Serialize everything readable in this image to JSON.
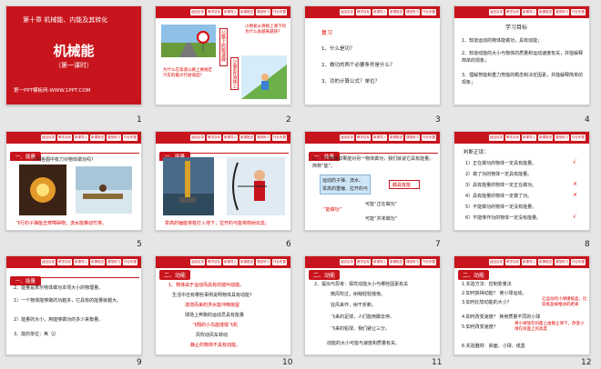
{
  "toolbar": [
    "返回目录",
    "教学目标",
    "新课导入",
    "新课推进",
    "课堂练习",
    "作业布置"
  ],
  "slide1": {
    "num": "1",
    "chapter": "第十章  机械能、内能及其转化",
    "title": "机械能",
    "subtitle": "（第一课时）",
    "site": "第一PPT模板网-WWW.1PPT.COM"
  },
  "slide2": {
    "num": "2",
    "callout_top": "小明发从滑梯上滑下的为什么会越来越快?",
    "road_sign": "公路上的限速牌",
    "callout_bottom": "为什么在高速公路上要规定汽车的最大行驶速度?",
    "slide_sign": "小朋友在滑梯上"
  },
  "slide3": {
    "num": "3",
    "heading": "复习",
    "items": [
      "1、什么是功？",
      "2、做功的两个必要条件是什么？",
      "3、功的计算公式？单位？"
    ]
  },
  "slide4": {
    "num": "4",
    "heading": "学习目标",
    "lines": [
      "1、知道运动的物体能做功，具有动能；",
      "2、知道动能的大小与物体的质量和运动速度有关，并能解释简单的现象；",
      "3、理解势能和重力势能的概念和决定因素，并能解释简单的现象；"
    ]
  },
  "slide5": {
    "num": "5",
    "tab": "一、能量",
    "question": "下列各图中有力对物体做功吗？",
    "caption": "飞行的子弹能击穿障碍物；流水能推动竹排。"
  },
  "slide6": {
    "num": "6",
    "tab": "一、能量",
    "caption": "举高的锤能将桩打入地下；拉开的弓能将箭射出去。"
  },
  "slide7": {
    "num": "7",
    "tab": "一、能量",
    "line1": "1、一个物体如果能对另一物体做功，我们就说它具有能量。简称“能”。",
    "box_lines": [
      "运动的子弹、流水、",
      "举高的重锤、拉开的弓"
    ],
    "has_energy": "都具有能",
    "can_do": "“能做功”",
    "doing": "可能“正在做功”",
    "not_doing": "可能“并未做功”"
  },
  "slide8": {
    "num": "8",
    "heading": "判断正误：",
    "items": [
      "1）正在做功的物体一定具有能量。",
      "2）做了功的物体一定具有能量。",
      "3）具有能量的物体一定正在做功。",
      "4）具有能量的物体一定做了功。",
      "5）不能做功的物体一定没有能量。",
      "6）不能够作功的物体一定没有能量。"
    ],
    "marks": [
      "√",
      "",
      "×",
      "×",
      "",
      "√"
    ]
  },
  "slide9": {
    "num": "9",
    "tab": "一、能量",
    "lines": [
      "2、能量是表示物体做功本领大小的物理量。",
      "1）一个物体能够做的功越多，它具有的能量就越大。",
      "2）能量的大小，用能够做功的多少来衡量。",
      "3、能的单位：焦（J）"
    ]
  },
  "slide10": {
    "num": "10",
    "tab": "二、动能",
    "lines": [
      "1、物体由于运动而具有的能叫动能。",
      "生活中还有哪些事例说明物体具有动能?",
      "湍流而来的洪水能冲倒房屋",
      "球场上奔跑的运动员具有能量",
      "飞翔的小鸟能撞毁飞机",
      "风吹动风车转动",
      "静止的物体不具有动能。"
    ]
  },
  "slide11": {
    "num": "11",
    "tab": "二、动能",
    "line1": "2、提出与思考：探究动能大小与哪些因素有关",
    "lines": [
      "微风吹过，树稍轻轻摇曳。",
      "狂风来作，树干折断。",
      "飞来的足球，人们能用脚去停。",
      "飞来的铅球，我们避让三分。"
    ],
    "conclusion": "动能的大小可能与速度和质量有关。"
  },
  "slide12": {
    "num": "12",
    "tab": "二、动能",
    "lines": [
      "1.实验方法：控制变量法",
      "2.如何获得动能？  使小球运动。",
      "3.如何比较动能的大小？",
      "4.如何改变速度？  换用质量不同的小球",
      "5.如何改变速度？",
      "6.实验器材：斜面、小球、纸盒"
    ],
    "answer3": "让运动的小球撞纸盒，比较纸盒被推动的距离",
    "answer5": "将小球放在斜面上由静止滑下，改变小球在斜面上的高度"
  }
}
